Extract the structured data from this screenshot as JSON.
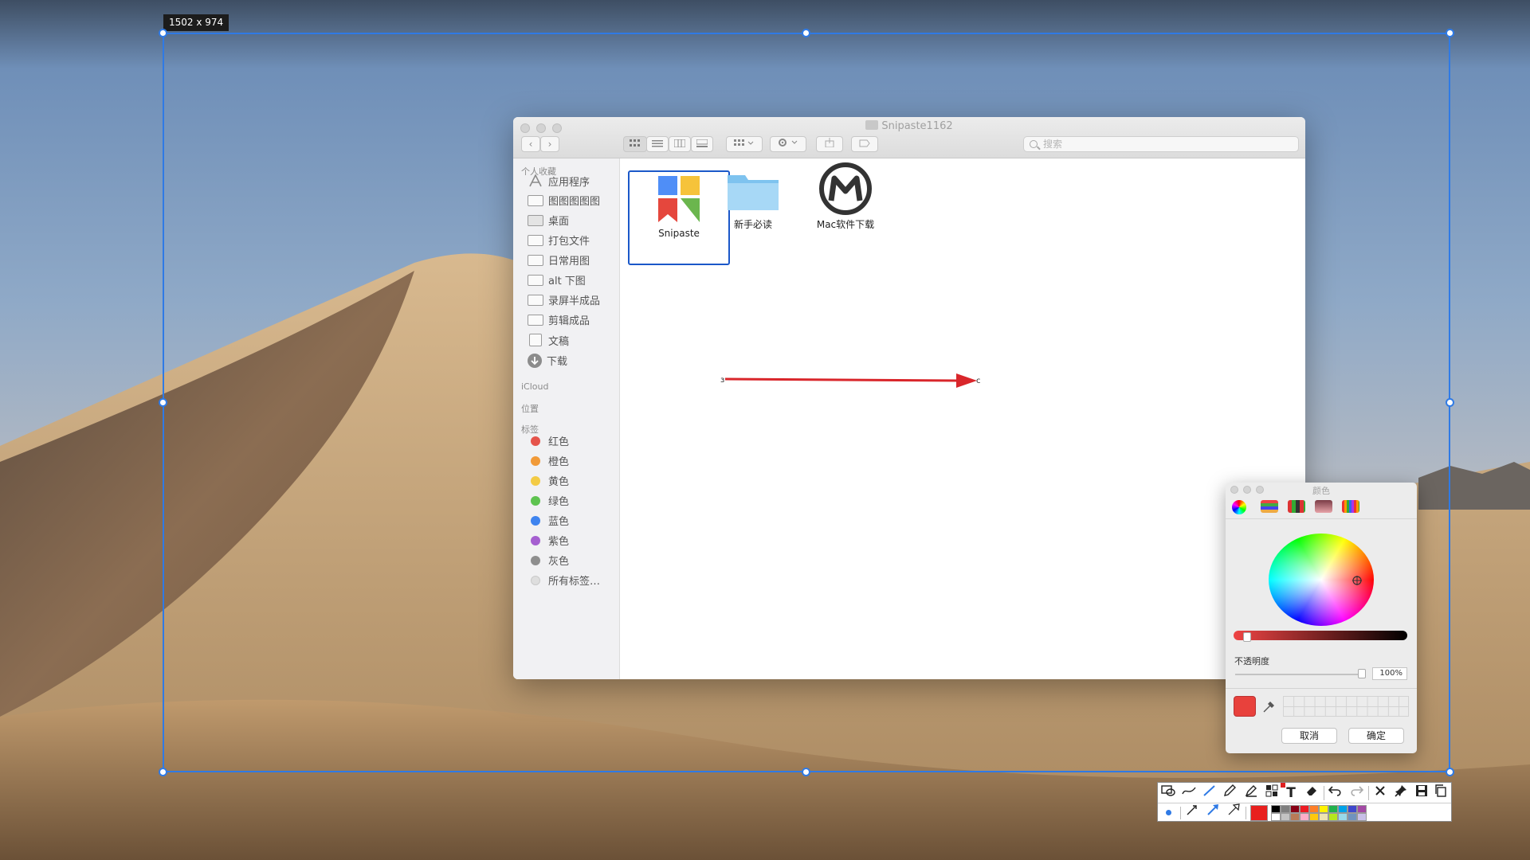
{
  "selection": {
    "dimensions_label": "1502 x 974"
  },
  "finder": {
    "title": "Snipaste1162",
    "nav": {
      "back": "‹",
      "forward": "›"
    },
    "search": {
      "placeholder": "搜索"
    },
    "sidebar": {
      "favorites_header": "个人收藏",
      "favorites": [
        {
          "label": "应用程序",
          "icon": "applications-icon"
        },
        {
          "label": "图图图图图",
          "icon": "folder-icon"
        },
        {
          "label": "桌面",
          "icon": "desktop-icon"
        },
        {
          "label": "打包文件",
          "icon": "folder-icon"
        },
        {
          "label": "日常用图",
          "icon": "folder-icon"
        },
        {
          "label": "alt 下图",
          "icon": "folder-icon"
        },
        {
          "label": "录屏半成品",
          "icon": "folder-icon"
        },
        {
          "label": "剪辑成品",
          "icon": "folder-icon"
        },
        {
          "label": "文稿",
          "icon": "documents-icon"
        },
        {
          "label": "下载",
          "icon": "downloads-icon"
        }
      ],
      "icloud_header": "iCloud",
      "locations_header": "位置",
      "tags_header": "标签",
      "tags": [
        {
          "label": "红色",
          "color": "#e5544b"
        },
        {
          "label": "橙色",
          "color": "#f19a38"
        },
        {
          "label": "黄色",
          "color": "#f3cb45"
        },
        {
          "label": "绿色",
          "color": "#5ec350"
        },
        {
          "label": "蓝色",
          "color": "#3f84ef"
        },
        {
          "label": "紫色",
          "color": "#a55fd0"
        },
        {
          "label": "灰色",
          "color": "#8e8e8e"
        },
        {
          "label": "所有标签…",
          "color": "#dedede"
        }
      ]
    },
    "files": [
      {
        "name": "Snipaste",
        "selected": true
      },
      {
        "name": "新手必读",
        "selected": false
      },
      {
        "name": "Mac软件下载",
        "selected": false
      }
    ]
  },
  "color_panel": {
    "title": "颜色",
    "opacity_label": "不透明度",
    "opacity_value": "100%",
    "current_color": "#e8413c",
    "cancel_label": "取消",
    "ok_label": "确定"
  },
  "annotation": {
    "arrow_color": "#d9262b"
  },
  "toolbar": {
    "tools_row1": [
      "rectangle-icon",
      "ellipse-icon",
      "line-icon",
      "arrow-icon",
      "pencil-icon",
      "marker-icon",
      "mosaic-icon",
      "text-icon",
      "eraser-icon",
      "undo-icon",
      "redo-icon",
      "close-icon",
      "pin-icon",
      "save-icon",
      "copy-icon"
    ],
    "text_tool_glyph": "T",
    "palette": [
      "#000000",
      "#7f7f7f",
      "#880015",
      "#ed1c24",
      "#ff7f27",
      "#fff200",
      "#22b14c",
      "#00a2e8",
      "#3f48cc",
      "#a349a4",
      "#ffffff",
      "#c3c3c3",
      "#b97a57",
      "#ffaec9",
      "#ffc90e",
      "#efe4b0",
      "#b5e61d",
      "#99d9ea",
      "#7092be",
      "#c8bfe7"
    ]
  }
}
